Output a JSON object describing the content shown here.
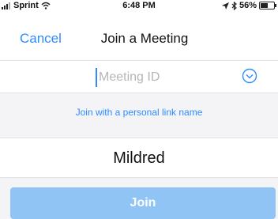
{
  "status_bar": {
    "carrier": "Sprint",
    "time": "6:48 PM",
    "battery": "56%"
  },
  "nav": {
    "cancel_label": "Cancel",
    "title": "Join a Meeting"
  },
  "meeting_id": {
    "placeholder": "Meeting ID",
    "value": ""
  },
  "personal_link_label": "Join with a personal link name",
  "name_value": "Mildred",
  "join_label": "Join",
  "colors": {
    "accent": "#2d8cff",
    "join_button_disabled": "#8fc4f5",
    "band_gray": "#f4f4f6"
  },
  "icons": {
    "status_left": [
      "signal-icon",
      "wifi-icon"
    ],
    "status_right": [
      "location-icon",
      "bluetooth-icon",
      "battery-icon"
    ],
    "id_field": "chevron-down-circle-icon"
  }
}
